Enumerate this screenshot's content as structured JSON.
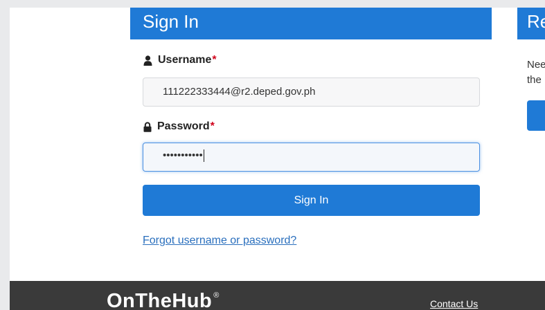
{
  "signin_panel": {
    "title": "Sign In",
    "username": {
      "label": "Username",
      "required_mark": "*",
      "value": "111222333444@r2.deped.gov.ph"
    },
    "password": {
      "label": "Password",
      "required_mark": "*",
      "value": "•••••••••••"
    },
    "submit_label": "Sign In",
    "forgot_link": "Forgot username or password?"
  },
  "register_panel": {
    "title_partial": "Re",
    "text_line1": "Nee",
    "text_line2": "the"
  },
  "footer": {
    "logo_text": "OnTheHub",
    "logo_mark": "®",
    "contact_link": "Contact Us"
  },
  "colors": {
    "accent": "#1f7ad6",
    "footer_bg": "#3a3a3a",
    "link": "#2a6fbd",
    "required": "#d0021b"
  },
  "icons": {
    "username": "user-icon",
    "password": "lock-icon"
  }
}
